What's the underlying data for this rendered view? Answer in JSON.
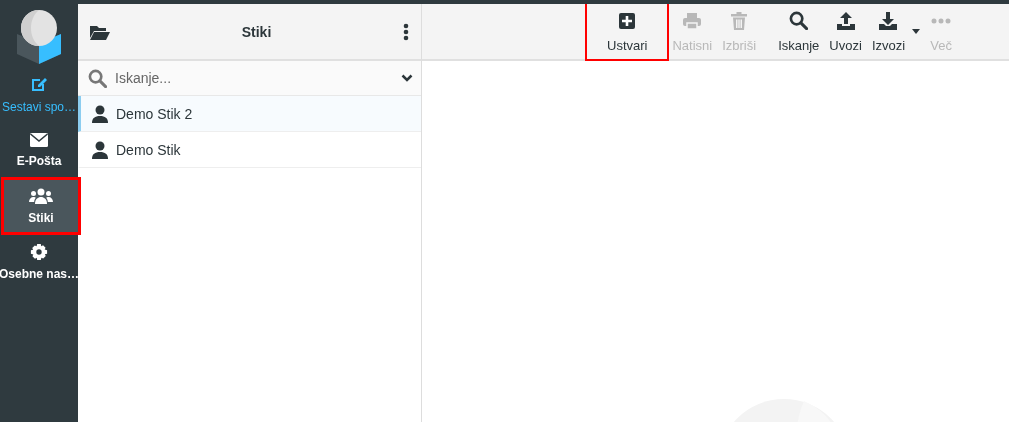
{
  "nav": [
    {
      "label": "Sestavi spo…",
      "kind": "compose",
      "selected": false,
      "accent": true,
      "highlighted": false
    },
    {
      "label": "E-Pošta",
      "kind": "mail",
      "selected": false,
      "accent": false,
      "highlighted": false
    },
    {
      "label": "Stiki",
      "kind": "contacts",
      "selected": true,
      "accent": false,
      "highlighted": true
    },
    {
      "label": "Osebne nas…",
      "kind": "settings",
      "selected": false,
      "accent": false,
      "highlighted": false
    }
  ],
  "list_panel": {
    "title": "Stiki",
    "search": {
      "placeholder": "Iskanje..."
    },
    "contacts": [
      {
        "name": "Demo Stik 2",
        "selected": true
      },
      {
        "name": "Demo Stik",
        "selected": false
      }
    ]
  },
  "toolbar": [
    {
      "label": "Ustvari",
      "kind": "create",
      "disabled": false,
      "highlighted": true,
      "dropdown": false
    },
    {
      "label": "Natisni",
      "kind": "print",
      "disabled": true,
      "highlighted": false,
      "dropdown": false
    },
    {
      "label": "Izbriši",
      "kind": "delete",
      "disabled": true,
      "highlighted": false,
      "dropdown": false
    },
    {
      "label": "Iskanje",
      "kind": "search",
      "disabled": false,
      "highlighted": false,
      "dropdown": false
    },
    {
      "label": "Uvozi",
      "kind": "upload",
      "disabled": false,
      "highlighted": false,
      "dropdown": false
    },
    {
      "label": "Izvozi",
      "kind": "download",
      "disabled": false,
      "highlighted": false,
      "dropdown": true
    },
    {
      "label": "Več",
      "kind": "more",
      "disabled": true,
      "highlighted": false,
      "dropdown": false
    }
  ]
}
